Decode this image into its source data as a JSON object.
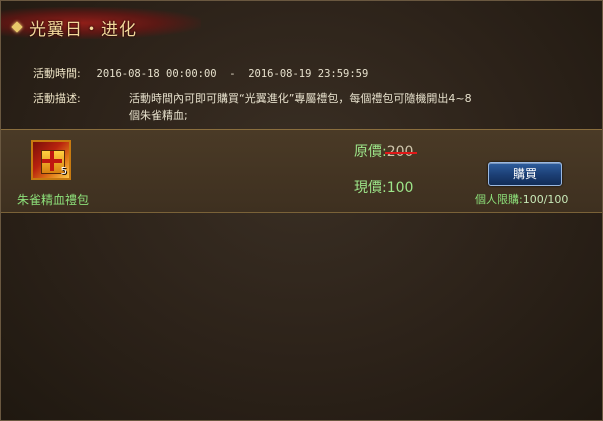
{
  "title": "光翼日・进化",
  "event_time": {
    "label": "活動時間:",
    "value": "2016-08-18 00:00:00  -  2016-08-19 23:59:59"
  },
  "event_desc": {
    "label": "活動描述:",
    "line1": "活動時間內可即可購買“光翼進化”專屬禮包，每個禮包可隨機開出4~8",
    "line2": "個朱雀精血;"
  },
  "item": {
    "name": "朱雀精血禮包",
    "count": "5",
    "icon": "gift-box-icon"
  },
  "price": {
    "original_label": "原價:",
    "original_value": "200",
    "current_label": "現價:",
    "current_value": "100"
  },
  "buy_button": {
    "label": "購買"
  },
  "limit": {
    "label": "個人限購:",
    "value": "100/100"
  }
}
